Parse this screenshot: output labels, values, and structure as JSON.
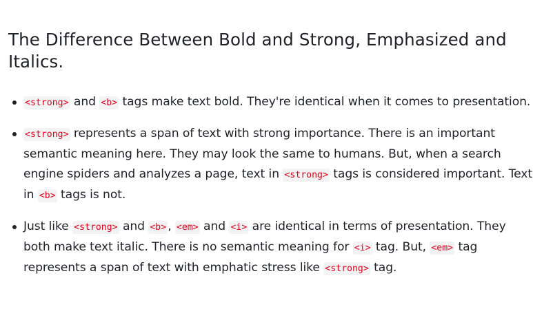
{
  "heading": "The Difference Between Bold and Strong, Emphasized and Italics.",
  "items": [
    {
      "segments": [
        {
          "t": "code",
          "v": "<strong>"
        },
        {
          "t": "text",
          "v": " and "
        },
        {
          "t": "code",
          "v": "<b>"
        },
        {
          "t": "text",
          "v": " tags make text bold. They're identical when it comes to presentation."
        }
      ]
    },
    {
      "segments": [
        {
          "t": "code",
          "v": "<strong>"
        },
        {
          "t": "text",
          "v": " represents a span of text with strong importance. There is an important semantic meaning here. They may look the same to humans. But, when a search engine spiders and analyzes a page, text in "
        },
        {
          "t": "code",
          "v": "<strong>"
        },
        {
          "t": "text",
          "v": " tags is considered important. Text in "
        },
        {
          "t": "code",
          "v": "<b>"
        },
        {
          "t": "text",
          "v": " tags is not."
        }
      ]
    },
    {
      "segments": [
        {
          "t": "text",
          "v": "Just like "
        },
        {
          "t": "code",
          "v": "<strong>"
        },
        {
          "t": "text",
          "v": " and "
        },
        {
          "t": "code",
          "v": "<b>"
        },
        {
          "t": "text",
          "v": ", "
        },
        {
          "t": "code",
          "v": "<em>"
        },
        {
          "t": "text",
          "v": " and "
        },
        {
          "t": "code",
          "v": "<i>"
        },
        {
          "t": "text",
          "v": " are identical in terms of presentation. They both make text italic. There is no semantic meaning for "
        },
        {
          "t": "code",
          "v": "<i>"
        },
        {
          "t": "text",
          "v": " tag. But, "
        },
        {
          "t": "code",
          "v": "<em>"
        },
        {
          "t": "text",
          "v": " tag represents a span of text with emphatic stress like "
        },
        {
          "t": "code",
          "v": "<strong>"
        },
        {
          "t": "text",
          "v": " tag."
        }
      ]
    }
  ]
}
